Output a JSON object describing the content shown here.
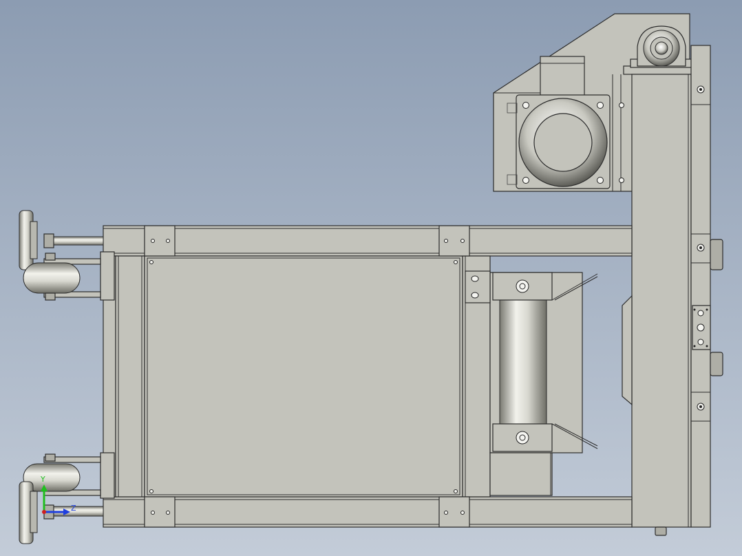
{
  "viewport": {
    "background_top": "#8c9cb2",
    "background_bottom": "#c3ccd8",
    "part_color": "#c3c3bb"
  },
  "triad": {
    "y_label": "Y",
    "z_label": "Z",
    "y_color": "#1fbf1f",
    "z_color": "#1f3fdf",
    "x_color": "#d01f1f"
  }
}
